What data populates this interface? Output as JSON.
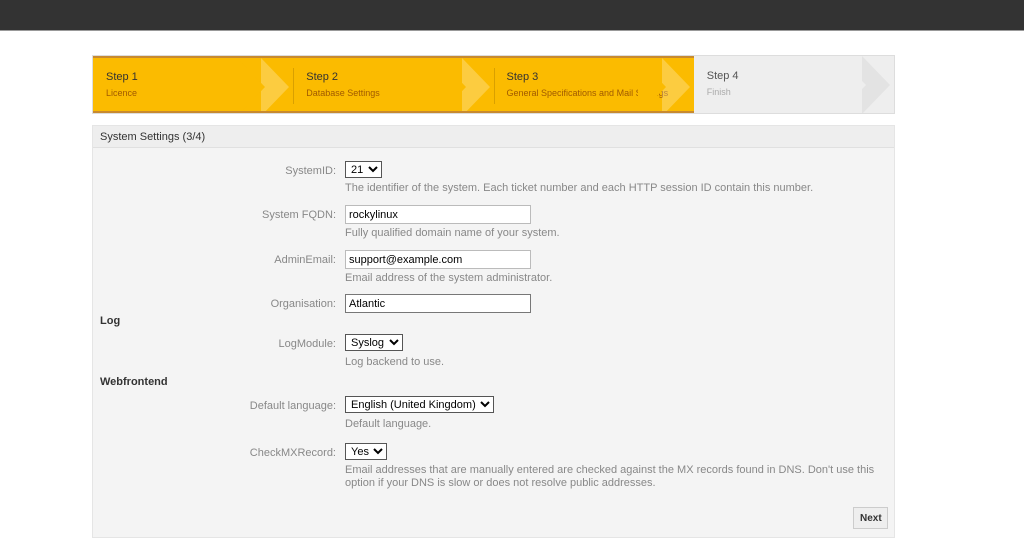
{
  "steps": [
    {
      "title": "Step 1",
      "subtitle": "Licence",
      "done": true
    },
    {
      "title": "Step 2",
      "subtitle": "Database Settings",
      "done": true
    },
    {
      "title": "Step 3",
      "subtitle": "General Specifications and Mail Settings",
      "done": true
    },
    {
      "title": "Step 4",
      "subtitle": "Finish",
      "done": false
    }
  ],
  "panel": {
    "title": "System Settings (3/4)",
    "system_id": {
      "label": "SystemID:",
      "value": "21",
      "help": "The identifier of the system. Each ticket number and each HTTP session ID contain this number."
    },
    "fqdn": {
      "label": "System FQDN:",
      "value": "rockylinux",
      "help": "Fully qualified domain name of your system."
    },
    "admin_email": {
      "label": "AdminEmail:",
      "value": "support@example.com",
      "help": "Email address of the system administrator."
    },
    "organisation": {
      "label": "Organisation:",
      "value": "Atlantic"
    },
    "log_section": "Log",
    "log_module": {
      "label": "LogModule:",
      "value": "Syslog",
      "help": "Log backend to use."
    },
    "web_section": "Webfrontend",
    "default_language": {
      "label": "Default language:",
      "value": "English (United Kingdom)",
      "help": "Default language."
    },
    "check_mx": {
      "label": "CheckMXRecord:",
      "value": "Yes",
      "help": "Email addresses that are manually entered are checked against the MX records found in DNS. Don't use this option if your DNS is slow or does not resolve public addresses."
    },
    "next_label": "Next"
  },
  "colors": {
    "step_active": "#fbbb00",
    "step_inactive": "#eeeeee",
    "topbar": "#333333"
  }
}
